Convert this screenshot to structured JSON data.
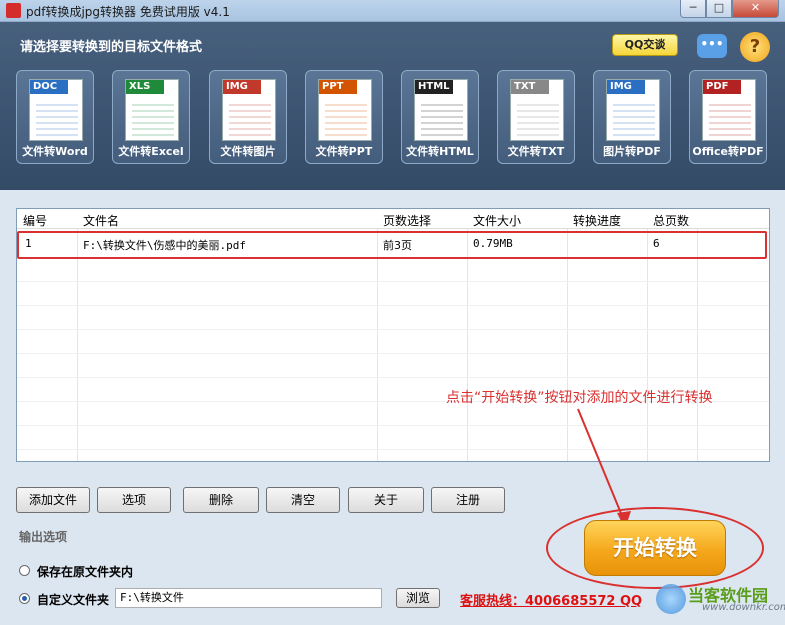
{
  "window": {
    "title": "pdf转换成jpg转换器 免费试用版 v4.1",
    "min": "─",
    "max": "□",
    "close": "✕"
  },
  "header": {
    "title": "请选择要转换到的目标文件格式",
    "qq_button": "QQ交谈",
    "help": "?"
  },
  "tiles": [
    {
      "tag": "DOC",
      "label": "文件转Word",
      "color": "#2b6fc2"
    },
    {
      "tag": "XLS",
      "label": "文件转Excel",
      "color": "#1f8a3a"
    },
    {
      "tag": "IMG",
      "label": "文件转图片",
      "color": "#c0392b"
    },
    {
      "tag": "PPT",
      "label": "文件转PPT",
      "color": "#d35400"
    },
    {
      "tag": "HTML",
      "label": "文件转HTML",
      "color": "#222222"
    },
    {
      "tag": "TXT",
      "label": "文件转TXT",
      "color": "#888888"
    },
    {
      "tag": "IMG",
      "label": "图片转PDF",
      "color": "#2b6fc2"
    },
    {
      "tag": "PDF",
      "label": "Office转PDF",
      "color": "#b22222"
    }
  ],
  "table": {
    "columns": [
      "编号",
      "文件名",
      "页数选择",
      "文件大小",
      "转换进度",
      "总页数"
    ],
    "rows": [
      {
        "id": "1",
        "name": "F:\\转换文件\\伤感中的美丽.pdf",
        "pages": "前3页",
        "size": "0.79MB",
        "progress": "",
        "total": "6"
      }
    ]
  },
  "buttons": {
    "add": "添加文件",
    "options": "选项",
    "delete": "删除",
    "clear": "清空",
    "about": "关于",
    "register": "注册"
  },
  "output": {
    "section": "输出选项",
    "opt_original": "保存在原文件夹内",
    "opt_custom": "自定义文件夹",
    "path": "F:\\转换文件",
    "browse": "浏览",
    "selected": "custom"
  },
  "hotline": "客服热线：4006685572 QQ",
  "start_button": "开始转换",
  "annotation": "点击“开始转换”按钮对添加的文件进行转换",
  "watermark": {
    "name": "当客软件园",
    "url": "www.downkr.com"
  },
  "colors": {
    "accent_red": "#d93030",
    "header_bg": "#3b5370",
    "start_orange": "#f5a81c"
  }
}
